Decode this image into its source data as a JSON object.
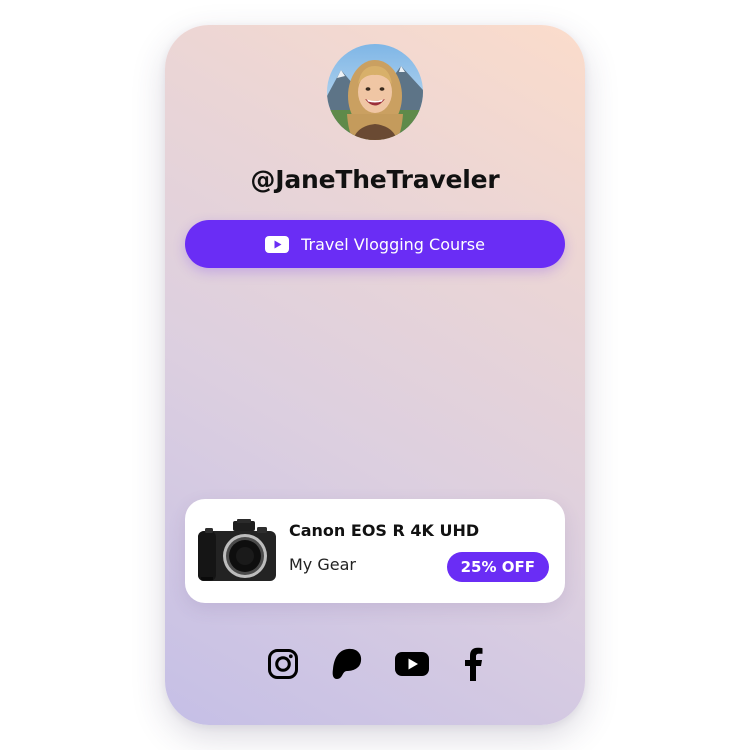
{
  "profile": {
    "handle": "@JaneTheTraveler",
    "avatar": "smiling-woman-mountains-photo"
  },
  "links": [
    {
      "label": "Travel Vlogging Course",
      "icon": "youtube-icon"
    }
  ],
  "product": {
    "title": "Canon EOS R 4K UHD",
    "subtitle": "My Gear",
    "badge": "25% OFF",
    "image": "camera-photo"
  },
  "socials": [
    {
      "name": "instagram",
      "icon": "instagram-icon"
    },
    {
      "name": "patreon",
      "icon": "patreon-icon"
    },
    {
      "name": "youtube",
      "icon": "youtube-icon"
    },
    {
      "name": "facebook",
      "icon": "facebook-icon"
    }
  ],
  "colors": {
    "accent": "#6a2df5",
    "text": "#111111",
    "card_gradient_top": "#fbdccb",
    "card_gradient_bottom": "#c5bfe6"
  }
}
